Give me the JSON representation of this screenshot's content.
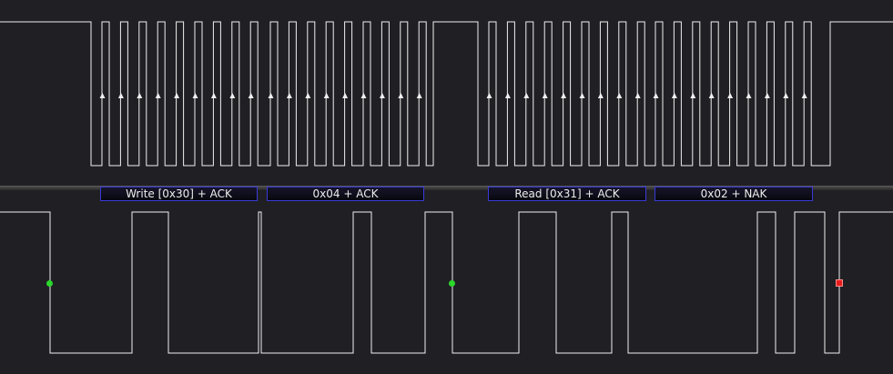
{
  "theme": {
    "background": "#1f1f24",
    "trace_color": "#f0f0f0",
    "label_border": "#3a3ad8",
    "start_marker": "#2bd82b",
    "stop_marker": "#e81c1c"
  },
  "decoded_labels": [
    "Write [0x30] + ACK",
    "0x04 + ACK",
    "Read [0x31] + ACK",
    "0x02 + NAK"
  ],
  "markers": {
    "start_icon": "green-dot",
    "stop_icon": "red-square"
  }
}
